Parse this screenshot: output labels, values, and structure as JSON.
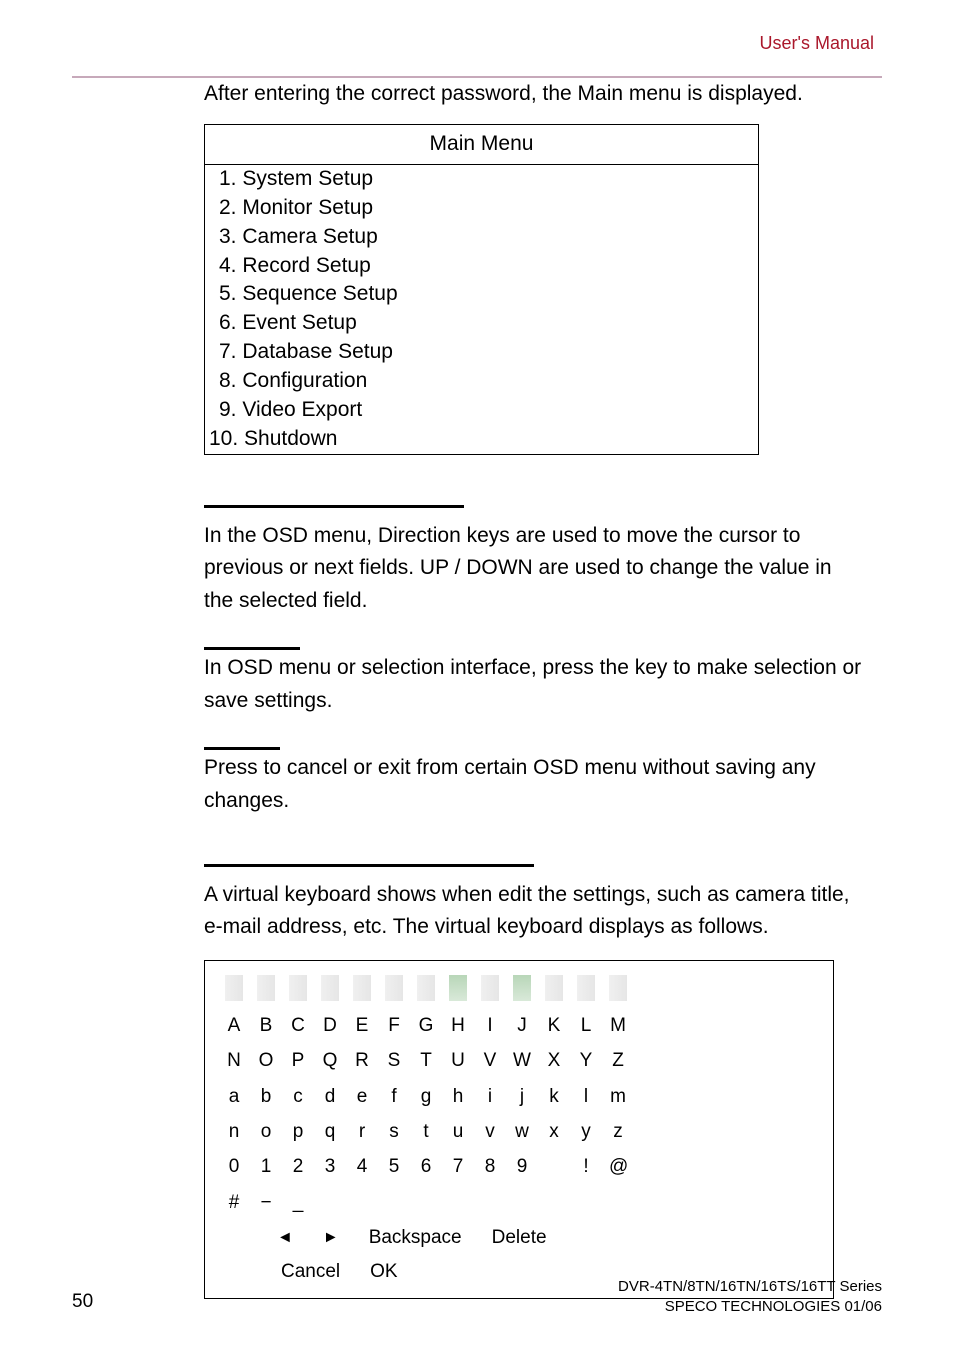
{
  "header": {
    "manual_label": "User's Manual"
  },
  "content": {
    "intro": "After entering the correct password, the Main menu is displayed.",
    "menu": {
      "title": "Main Menu",
      "items": [
        "1. System Setup",
        "2. Monitor Setup",
        "3. Camera Setup",
        "4. Record Setup",
        "5. Sequence Setup",
        "6. Event Setup",
        "7. Database Setup",
        "8. Configuration",
        "9. Video Export",
        "10. Shutdown"
      ]
    },
    "direction_para": "In the OSD menu, Direction keys are used to move the cursor to previous or next fields. UP / DOWN are used to change the value in the selected field.",
    "osd_para": "In OSD menu or selection interface, press the key to make selection or save settings.",
    "cancel_para": "Press to cancel or exit from certain OSD menu without saving any changes.",
    "vk_para": "A virtual keyboard shows when edit the settings, such as camera title, e-mail address, etc. The virtual keyboard displays as follows.",
    "keyboard": {
      "rows": [
        [
          "A",
          "B",
          "C",
          "D",
          "E",
          "F",
          "G",
          "H",
          "I",
          "J",
          "K",
          "L",
          "M"
        ],
        [
          "N",
          "O",
          "P",
          "Q",
          "R",
          "S",
          "T",
          "U",
          "V",
          "W",
          "X",
          "Y",
          "Z"
        ],
        [
          "a",
          "b",
          "c",
          "d",
          "e",
          "f",
          "g",
          "h",
          "i",
          "j",
          "k",
          "l",
          "m"
        ],
        [
          "n",
          "o",
          "p",
          "q",
          "r",
          "s",
          "t",
          "u",
          "v",
          "w",
          "x",
          "y",
          "z"
        ],
        [
          "0",
          "1",
          "2",
          "3",
          "4",
          "5",
          "6",
          "7",
          "8",
          "9",
          "",
          "!",
          "@"
        ],
        [
          "#",
          "−",
          "_"
        ]
      ],
      "ctrl1": {
        "left": "◄",
        "right": "►",
        "backspace": "Backspace",
        "delete": "Delete"
      },
      "ctrl2": {
        "cancel": "Cancel",
        "ok": "OK"
      }
    }
  },
  "footer": {
    "page": "50",
    "product": "DVR-4TN/8TN/16TN/16TS/16TT Series",
    "company": "SPECO TECHNOLOGIES 01/06"
  }
}
